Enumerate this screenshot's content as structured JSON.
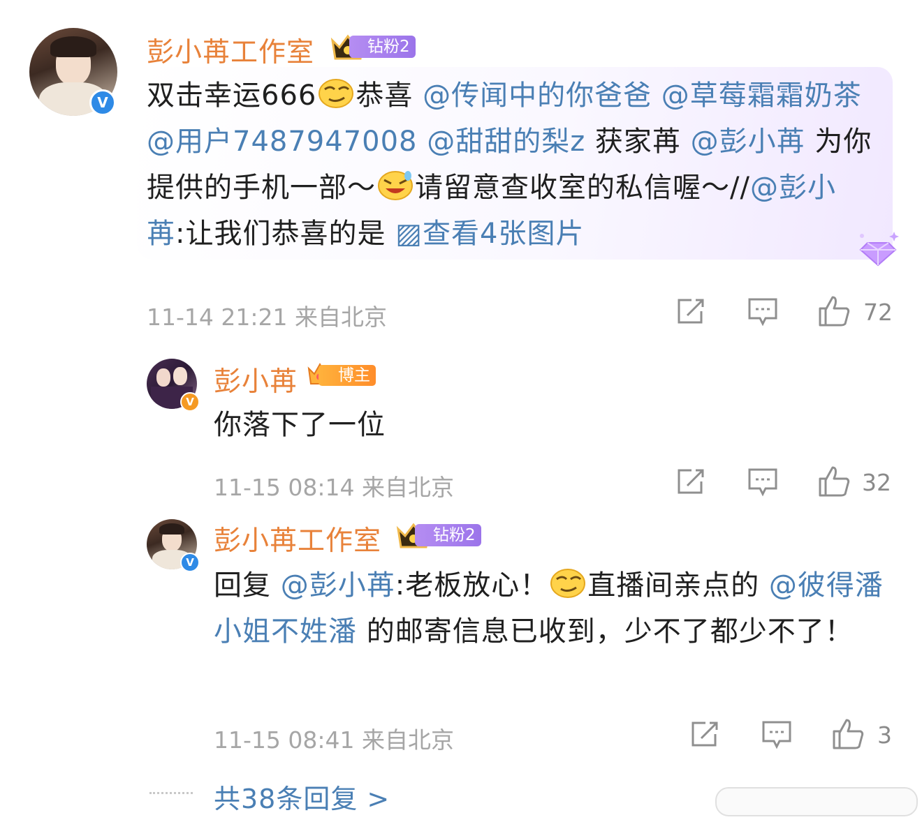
{
  "main_comment": {
    "author": "彭小苒工作室",
    "fan_badge": "钻粉2",
    "content_parts": [
      {
        "t": "text",
        "v": "双击幸运666"
      },
      {
        "t": "emoji",
        "v": "smirk-emoji"
      },
      {
        "t": "text",
        "v": "恭喜 "
      },
      {
        "t": "link",
        "v": "@传闻中的你爸爸"
      },
      {
        "t": "text",
        "v": " "
      },
      {
        "t": "link",
        "v": "@草莓霜霜奶茶"
      },
      {
        "t": "text",
        "v": " "
      },
      {
        "t": "link",
        "v": "@用户7487947008"
      },
      {
        "t": "text",
        "v": " "
      },
      {
        "t": "link",
        "v": "@甜甜的梨z"
      },
      {
        "t": "text",
        "v": " 获家苒 "
      },
      {
        "t": "link",
        "v": "@彭小苒"
      },
      {
        "t": "text",
        "v": " 为你提供的手机一部～"
      },
      {
        "t": "emoji",
        "v": "laugh-emoji"
      },
      {
        "t": "text",
        "v": "请留意查收室的私信喔～//"
      },
      {
        "t": "link",
        "v": "@彭小苒"
      },
      {
        "t": "text",
        "v": ":让我们恭喜的是 "
      },
      {
        "t": "link",
        "v": "▨查看4张图片"
      }
    ],
    "time": "11-14 21:21 来自北京",
    "likes": "72"
  },
  "replies": [
    {
      "author": "彭小苒",
      "badge": "博主",
      "content_parts": [
        {
          "t": "text",
          "v": "你落下了一位"
        }
      ],
      "time": "11-15 08:14 来自北京",
      "likes": "32"
    },
    {
      "author": "彭小苒工作室",
      "badge": "钻粉2",
      "content_parts": [
        {
          "t": "text",
          "v": "回复 "
        },
        {
          "t": "link",
          "v": "@彭小苒"
        },
        {
          "t": "text",
          "v": ":老板放心！"
        },
        {
          "t": "emoji",
          "v": "smirk-emoji"
        },
        {
          "t": "text",
          "v": "直播间亲点的 "
        },
        {
          "t": "link",
          "v": "@彼得潘小姐不姓潘"
        },
        {
          "t": "text",
          "v": " 的邮寄信息已收到，少不了都少不了！"
        }
      ],
      "time": "11-15 08:41 来自北京",
      "likes": "3"
    }
  ],
  "more_replies": "共38条回复 >",
  "colors": {
    "name": "#e8823a",
    "link": "#4a7fb4",
    "meta": "#a6a6a6",
    "fan_badge": "#a57ff0",
    "verified_blue": "#2e8ae6",
    "verified_orange": "#f59a23"
  }
}
